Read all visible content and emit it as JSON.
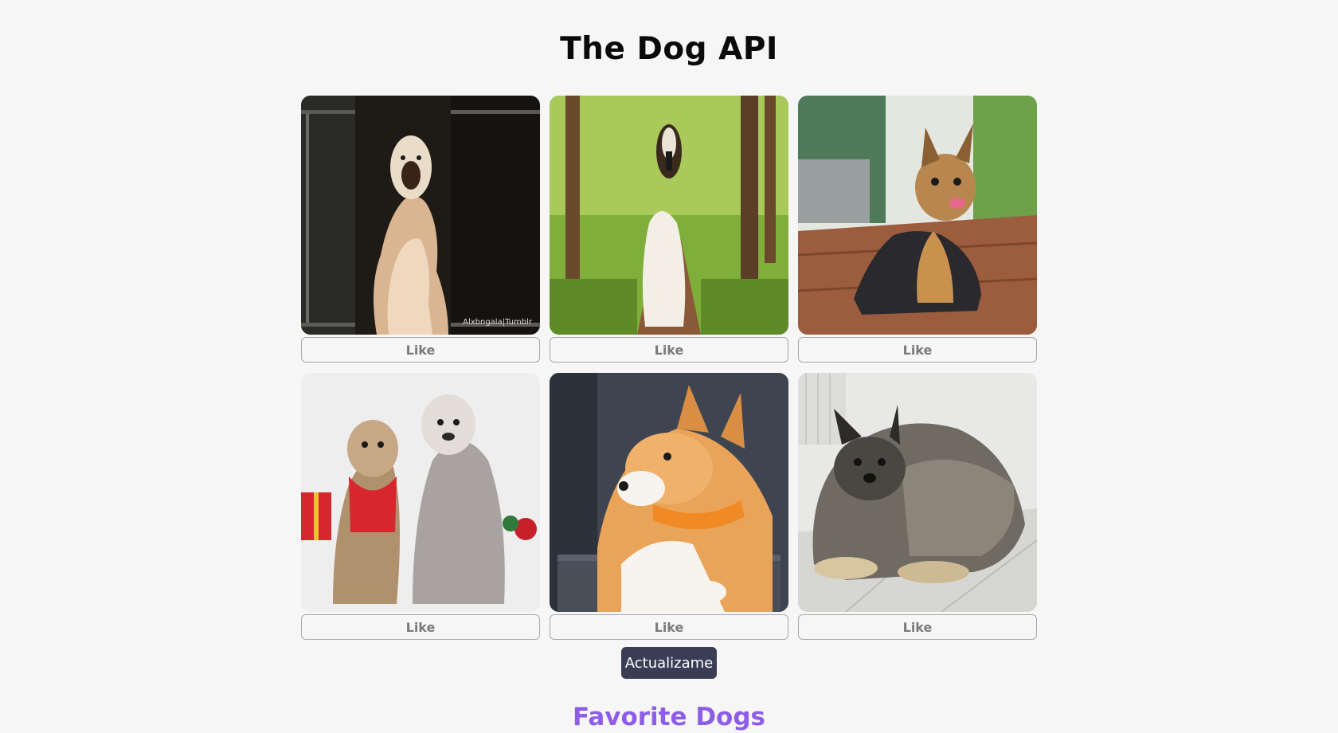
{
  "header": {
    "title": "The Dog API"
  },
  "dogs": [
    {
      "image_icon": "dog-painting-photo",
      "like_label": "Like"
    },
    {
      "image_icon": "afghan-hound-photo",
      "like_label": "Like"
    },
    {
      "image_icon": "yorkshire-terrier-photo",
      "like_label": "Like"
    },
    {
      "image_icon": "two-shaggy-dogs-photo",
      "like_label": "Like"
    },
    {
      "image_icon": "shiba-inu-photo",
      "like_label": "Like"
    },
    {
      "image_icon": "keeshond-photo",
      "like_label": "Like"
    }
  ],
  "refresh_label": "Actualizame",
  "favorites": {
    "title": "Favorite Dogs"
  },
  "colors": {
    "background": "#f6f6f6",
    "refresh_button": "#3a3d56",
    "favorites_title": "#8e5de8",
    "like_text": "#7a7a7a"
  }
}
